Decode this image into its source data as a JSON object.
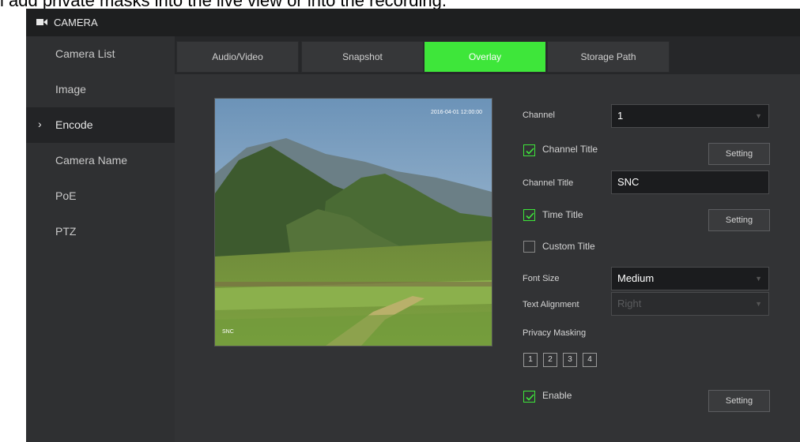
{
  "caption": "l add private masks into the live view or into the recording.",
  "title_bar": {
    "title": "CAMERA",
    "icon": "camera-icon"
  },
  "sidebar": {
    "items": [
      {
        "label": "Camera List",
        "active": false
      },
      {
        "label": "Image",
        "active": false
      },
      {
        "label": "Encode",
        "active": true,
        "marker": "›"
      },
      {
        "label": "Camera Name",
        "active": false
      },
      {
        "label": "PoE",
        "active": false
      },
      {
        "label": "PTZ",
        "active": false
      }
    ]
  },
  "tabs": [
    {
      "label": "Audio/Video",
      "active": false
    },
    {
      "label": "Snapshot",
      "active": false
    },
    {
      "label": "Overlay",
      "active": true
    },
    {
      "label": "Storage Path",
      "active": false
    }
  ],
  "preview": {
    "osd_time": "2016-04-01 12:00:00",
    "osd_name": "SNC"
  },
  "form": {
    "channel_label": "Channel",
    "channel_value": "1",
    "channel_title_checkbox": {
      "label": "Channel Title",
      "checked": true
    },
    "channel_title_setting": "Setting",
    "channel_title_field_label": "Channel Title",
    "channel_title_value": "SNC",
    "time_title_checkbox": {
      "label": "Time Title",
      "checked": true
    },
    "time_title_setting": "Setting",
    "custom_title_checkbox": {
      "label": "Custom Title",
      "checked": false
    },
    "font_size_label": "Font Size",
    "font_size_value": "Medium",
    "text_alignment_label": "Text Alignment",
    "text_alignment_value": "Right",
    "privacy_masking_label": "Privacy Masking",
    "mask_numbers": [
      "1",
      "2",
      "3",
      "4"
    ],
    "enable_checkbox": {
      "label": "Enable",
      "checked": true
    },
    "enable_setting": "Setting"
  },
  "colors": {
    "accent": "#3ee63a",
    "panel": "#323335",
    "sidebar": "#2f3032",
    "titlebar": "#1e1f20"
  }
}
